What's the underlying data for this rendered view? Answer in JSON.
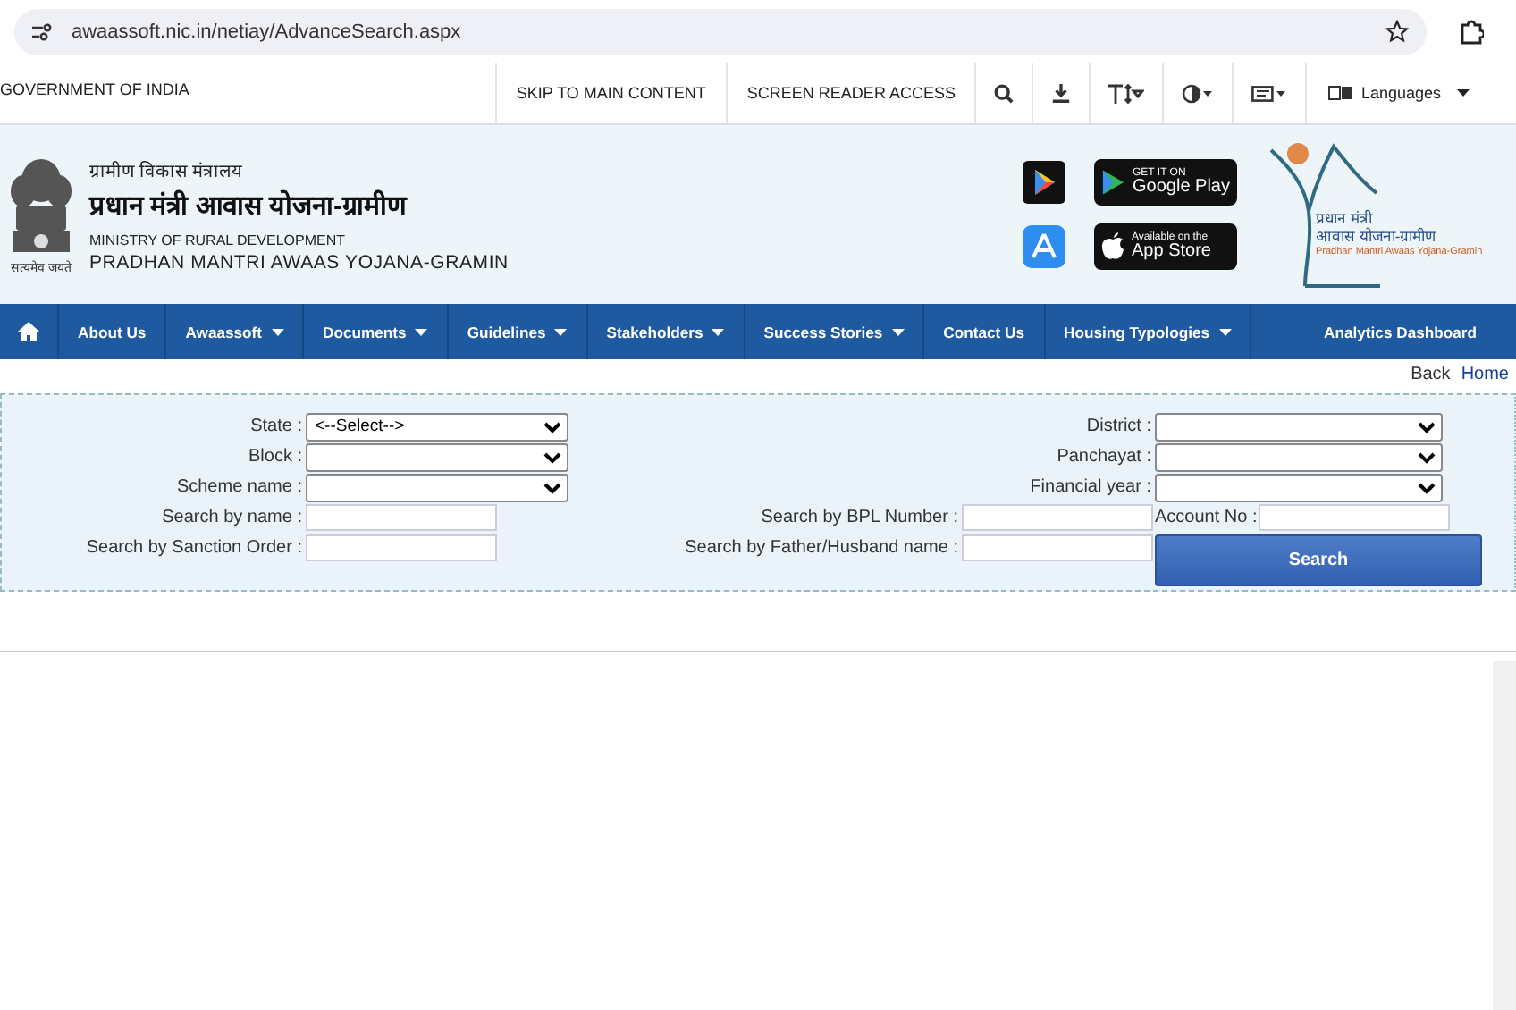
{
  "browser": {
    "url": "awaassoft.nic.in/netiay/AdvanceSearch.aspx"
  },
  "top_bar": {
    "title": "GOVERNMENT OF INDIA",
    "links": [
      "SKIP TO MAIN CONTENT",
      "SCREEN READER ACCESS"
    ],
    "languages": "Languages"
  },
  "header": {
    "emblem_motto": "सत्यमेव जयते",
    "ministry_hindi": "ग्रामीण विकास मंत्रालय",
    "scheme_hindi": "प्रधान मंत्री आवास योजना-ग्रामीण",
    "ministry": "MINISTRY OF RURAL DEVELOPMENT",
    "scheme": "PRADHAN MANTRI AWAAS YOJANA-GRAMIN",
    "google_play": {
      "caption": "GET IT ON",
      "name": "Google Play"
    },
    "app_store": {
      "caption": "Available on the",
      "name": "App Store"
    },
    "logo_text": [
      "प्रधान मंत्री",
      "आवास योजना-ग्रामीण",
      "Pradhan Mantri Awaas Yojana-Gramin"
    ]
  },
  "nav": {
    "items": [
      {
        "label": "About Us",
        "dropdown": false
      },
      {
        "label": "Awaassoft",
        "dropdown": true
      },
      {
        "label": "Documents",
        "dropdown": true
      },
      {
        "label": "Guidelines",
        "dropdown": true
      },
      {
        "label": "Stakeholders",
        "dropdown": true
      },
      {
        "label": "Success Stories",
        "dropdown": true
      },
      {
        "label": "Contact Us",
        "dropdown": false
      },
      {
        "label": "Housing Typologies",
        "dropdown": true
      }
    ],
    "right_item": "Analytics Dashboard"
  },
  "breadcrumb": [
    "Back",
    "Home"
  ],
  "form": {
    "rows": [
      [
        {
          "label": "State :",
          "kind": "select",
          "value": "<--Select-->"
        },
        {
          "label": "District :",
          "kind": "select"
        }
      ],
      [
        {
          "label": "Block :",
          "kind": "select"
        },
        {
          "label": "Panchayat :",
          "kind": "select"
        }
      ],
      [
        {
          "label": "Scheme name :",
          "kind": "select"
        },
        {
          "label": "Financial year :",
          "kind": "select"
        }
      ],
      [
        {
          "label": "Search by name :",
          "kind": "text"
        },
        {
          "label": "Search by BPL Number :",
          "kind": "text"
        },
        {
          "label": "Account No :",
          "kind": "text"
        }
      ],
      [
        {
          "label": "Search by Sanction Order :",
          "kind": "text"
        },
        {
          "label": "Search by Father/Husband name :",
          "kind": "text"
        }
      ]
    ],
    "search_button": "Search"
  }
}
